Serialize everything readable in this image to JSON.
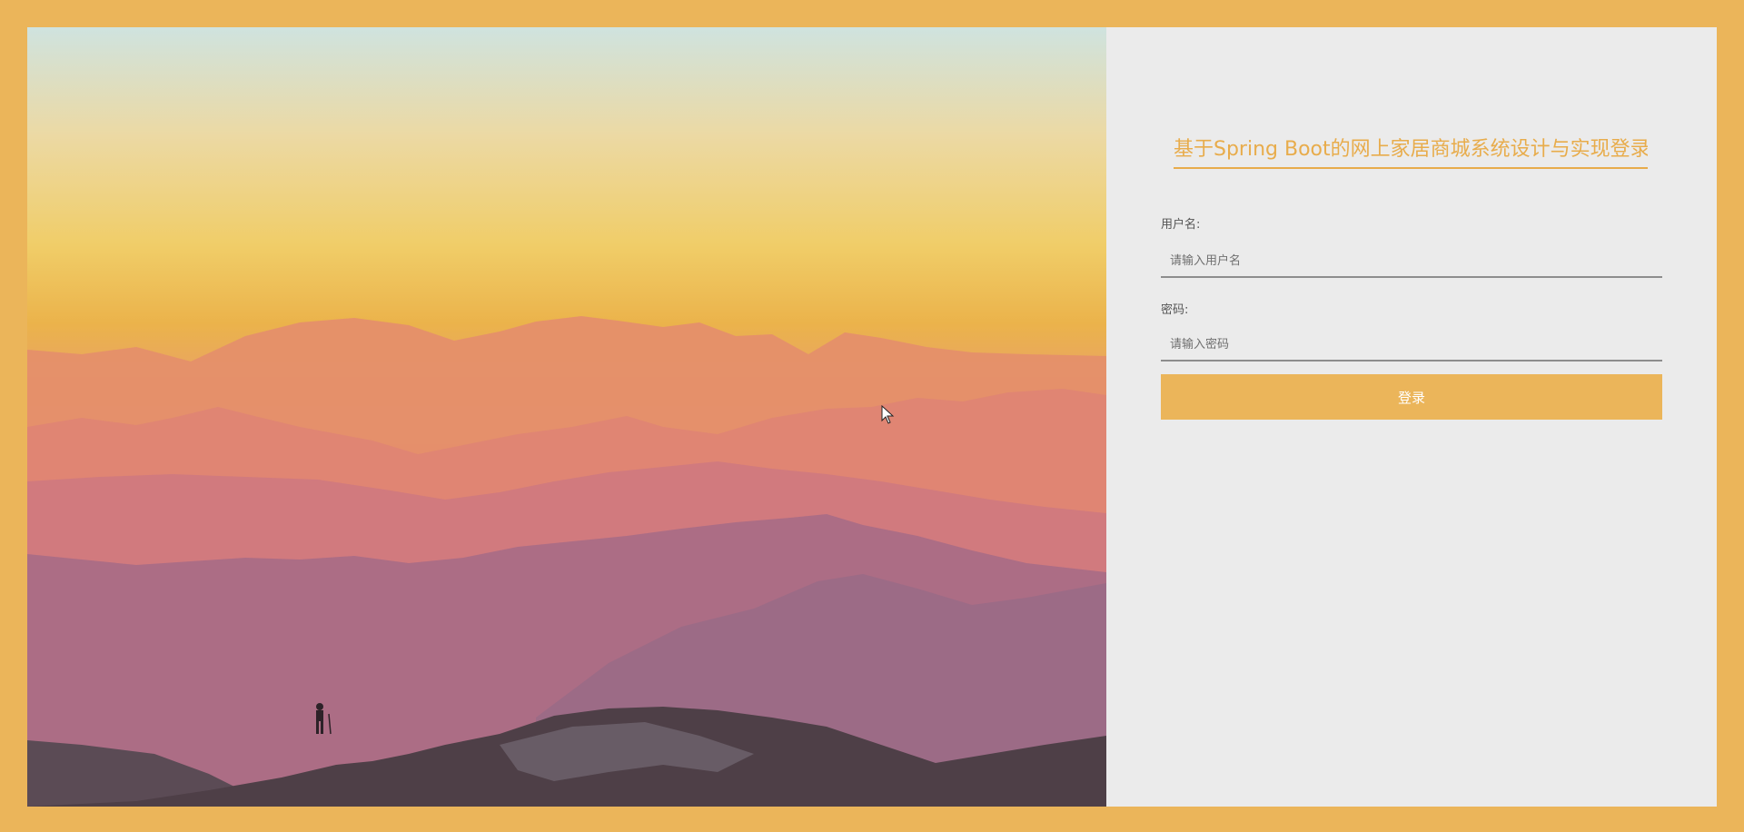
{
  "login": {
    "title": "基于Spring Boot的网上家居商城系统设计与实现登录",
    "username_label": "用户名:",
    "username_placeholder": "请输入用户名",
    "username_value": "",
    "password_label": "密码:",
    "password_placeholder": "请输入密码",
    "password_value": "",
    "submit_label": "登录"
  },
  "colors": {
    "frame": "#ebb55a",
    "accent": "#e8ac4b",
    "panel": "#ebebeb"
  },
  "icons": {
    "cursor": "mouse-pointer-icon"
  }
}
